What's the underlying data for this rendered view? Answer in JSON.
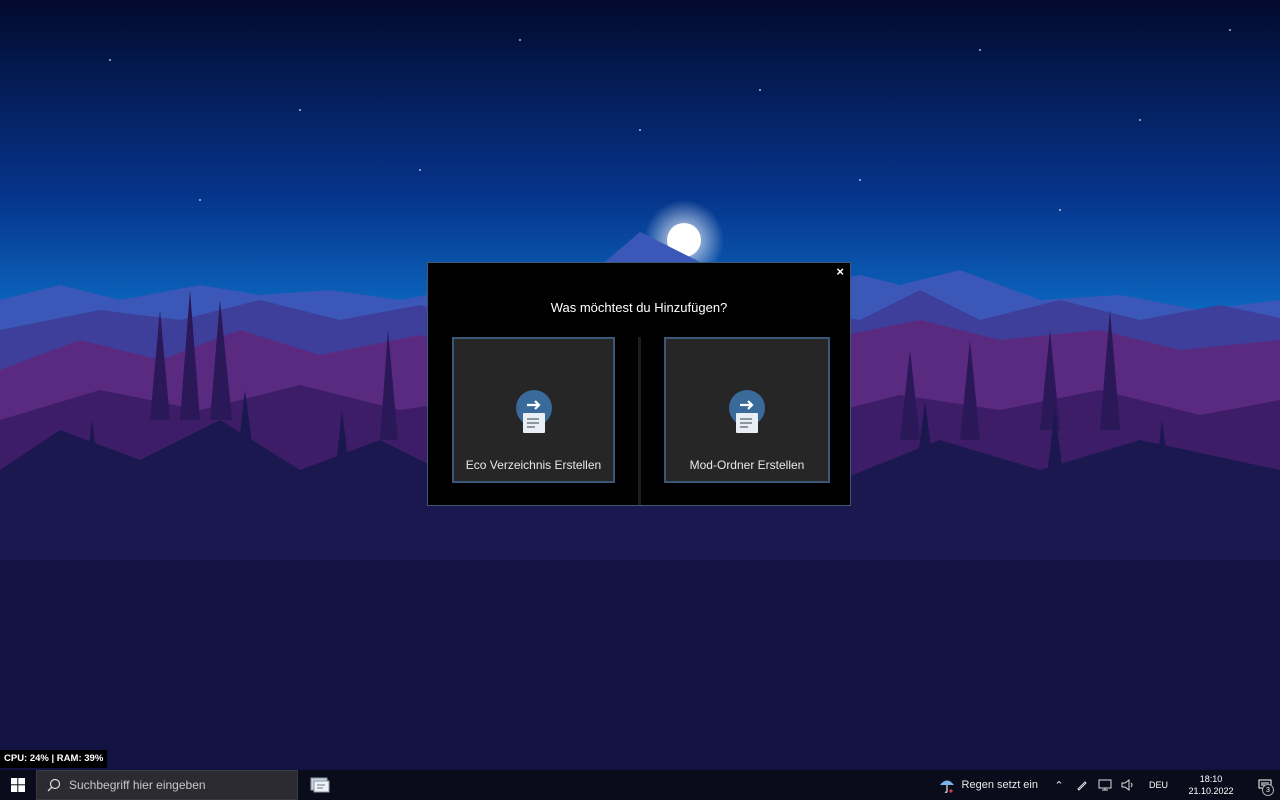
{
  "dialog": {
    "title": "Was möchtest du Hinzufügen?",
    "close_glyph": "×",
    "options": [
      {
        "label": "Eco Verzeichnis Erstellen",
        "icon": "folder-arrow-icon"
      },
      {
        "label": "Mod-Ordner Erstellen",
        "icon": "folder-arrow-icon"
      }
    ]
  },
  "perf": {
    "text": "CPU: 24%  |  RAM: 39%"
  },
  "taskbar": {
    "search_placeholder": "Suchbegriff hier eingeben",
    "weather_text": "Regen setzt ein",
    "language": "DEU",
    "time": "18:10",
    "date": "21.10.2022",
    "notification_count": "3"
  },
  "colors": {
    "dialog_bg": "#000000",
    "option_bg": "#262626",
    "option_border": "#3a5876",
    "icon_accent": "#3a6a9a"
  }
}
